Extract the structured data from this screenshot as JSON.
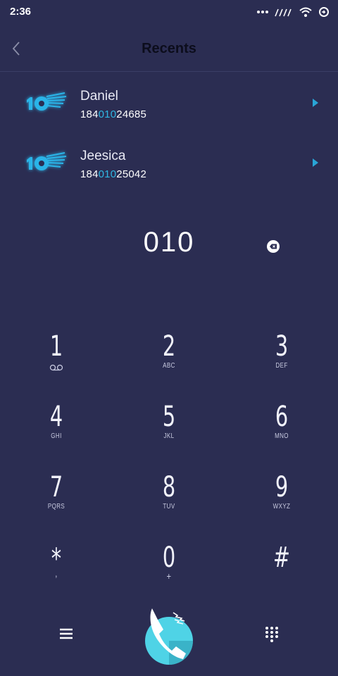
{
  "status": {
    "time": "2:36",
    "icons": [
      "more-dots-icon",
      "signal-icon",
      "wifi-icon",
      "sync-icon"
    ]
  },
  "header": {
    "title": "Recents",
    "back_icon": "chevron-left-icon"
  },
  "recents": [
    {
      "name": "Daniel",
      "number_prefix": "184",
      "number_match": "010",
      "number_suffix": "24685"
    },
    {
      "name": "Jeesica",
      "number_prefix": "184",
      "number_match": "010",
      "number_suffix": "25042"
    }
  ],
  "dialer": {
    "input": "010",
    "keys": [
      {
        "digit": "1",
        "letters": ""
      },
      {
        "digit": "2",
        "letters": "ABC"
      },
      {
        "digit": "3",
        "letters": "DEF"
      },
      {
        "digit": "4",
        "letters": "GHI"
      },
      {
        "digit": "5",
        "letters": "JKL"
      },
      {
        "digit": "6",
        "letters": "MNO"
      },
      {
        "digit": "7",
        "letters": "PQRS"
      },
      {
        "digit": "8",
        "letters": "TUV"
      },
      {
        "digit": "9",
        "letters": "WXYZ"
      },
      {
        "digit": "*",
        "letters": ","
      },
      {
        "digit": "0",
        "letters": "+"
      },
      {
        "digit": "#",
        "letters": ""
      }
    ]
  },
  "colors": {
    "background": "#2b2d52",
    "accent": "#2fb6e3",
    "call_button": "#4fd3e6"
  }
}
